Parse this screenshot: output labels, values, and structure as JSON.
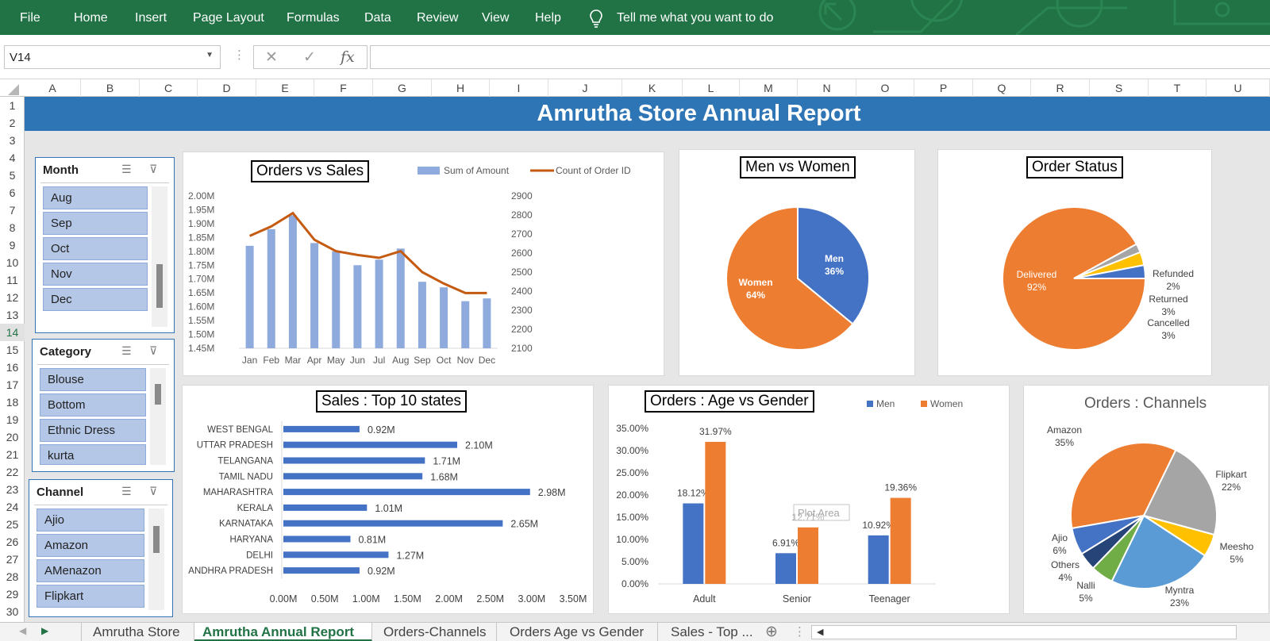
{
  "ribbon": {
    "tabs": [
      "File",
      "Home",
      "Insert",
      "Page Layout",
      "Formulas",
      "Data",
      "Review",
      "View",
      "Help"
    ],
    "tell_me": "Tell me what you want to do",
    "tell_me_icon": "lightbulb-icon",
    "bg_color": "#217346"
  },
  "formula_bar": {
    "name_box": "V14",
    "cancel_icon": "✕",
    "enter_icon": "✓",
    "fx_icon": "fx",
    "formula": ""
  },
  "grid": {
    "columns": [
      "A",
      "B",
      "C",
      "D",
      "E",
      "F",
      "G",
      "H",
      "I",
      "J",
      "K",
      "L",
      "M",
      "N",
      "O",
      "P",
      "Q",
      "R",
      "S",
      "T",
      "U"
    ],
    "rows": [
      "1",
      "2",
      "3",
      "4",
      "5",
      "6",
      "7",
      "8",
      "9",
      "10",
      "11",
      "12",
      "13",
      "14",
      "15",
      "16",
      "17",
      "18",
      "19",
      "20",
      "21",
      "22",
      "23",
      "24",
      "25",
      "26",
      "27",
      "28",
      "29",
      "30"
    ],
    "selected_row": "14"
  },
  "banner": {
    "title": "Amrutha Store Annual Report",
    "color": "#2e75b6"
  },
  "slicers": {
    "month": {
      "title": "Month",
      "items": [
        "Aug",
        "Sep",
        "Oct",
        "Nov",
        "Dec"
      ]
    },
    "category": {
      "title": "Category",
      "items": [
        "Blouse",
        "Bottom",
        "Ethnic Dress",
        "kurta"
      ]
    },
    "channel": {
      "title": "Channel",
      "items": [
        "Ajio",
        "Amazon",
        "AMenazon",
        "Flipkart"
      ]
    }
  },
  "chart_data": [
    {
      "id": "orders-vs-sales",
      "type": "bar",
      "title": "Orders vs Sales",
      "categories": [
        "Jan",
        "Feb",
        "Mar",
        "Apr",
        "May",
        "Jun",
        "Jul",
        "Aug",
        "Sep",
        "Oct",
        "Nov",
        "Dec"
      ],
      "series": [
        {
          "name": "Sum of Amount",
          "type": "bar",
          "axis": "left",
          "color": "#8faadc",
          "values": [
            1.82,
            1.88,
            1.93,
            1.83,
            1.8,
            1.75,
            1.77,
            1.81,
            1.69,
            1.67,
            1.62,
            1.63
          ]
        },
        {
          "name": "Count of Order ID",
          "type": "line",
          "axis": "right",
          "color": "#c55a11",
          "values": [
            2690,
            2740,
            2810,
            2670,
            2610,
            2590,
            2575,
            2610,
            2500,
            2440,
            2390,
            2390
          ]
        }
      ],
      "y_left": {
        "ticks": [
          "2.00M",
          "1.95M",
          "1.90M",
          "1.85M",
          "1.80M",
          "1.75M",
          "1.70M",
          "1.65M",
          "1.60M",
          "1.55M",
          "1.50M",
          "1.45M"
        ],
        "ylim": [
          1.45,
          2.0
        ]
      },
      "y_right": {
        "ticks": [
          "2900",
          "2800",
          "2700",
          "2600",
          "2500",
          "2400",
          "2300",
          "2200",
          "2100"
        ],
        "ylim": [
          2100,
          2900
        ]
      },
      "legend": "top-right"
    },
    {
      "id": "men-vs-women",
      "type": "pie",
      "title": "Men vs Women",
      "slices": [
        {
          "label": "Men",
          "value": 36,
          "text": "36%",
          "color": "#4472c4"
        },
        {
          "label": "Women",
          "value": 64,
          "text": "64%",
          "color": "#ed7d31"
        }
      ]
    },
    {
      "id": "order-status",
      "type": "pie",
      "title": "Order Status",
      "slices": [
        {
          "label": "Delivered",
          "value": 92,
          "text": "92%",
          "color": "#ed7d31"
        },
        {
          "label": "Refunded",
          "value": 2,
          "text": "2%",
          "color": "#a5a5a5"
        },
        {
          "label": "Returned",
          "value": 3,
          "text": "3%",
          "color": "#ffc000"
        },
        {
          "label": "Cancelled",
          "value": 3,
          "text": "3%",
          "color": "#4472c4"
        }
      ]
    },
    {
      "id": "top-states",
      "type": "bar",
      "orientation": "horizontal",
      "title": "Sales : Top 10 states",
      "categories": [
        "WEST BENGAL",
        "UTTAR PRADESH",
        "TELANGANA",
        "TAMIL NADU",
        "MAHARASHTRA",
        "KERALA",
        "KARNATAKA",
        "HARYANA",
        "DELHI",
        "ANDHRA PRADESH"
      ],
      "values": [
        0.92,
        2.1,
        1.71,
        1.68,
        2.98,
        1.01,
        2.65,
        0.81,
        1.27,
        0.92
      ],
      "labels": [
        "0.92M",
        "2.10M",
        "1.71M",
        "1.68M",
        "2.98M",
        "1.01M",
        "2.65M",
        "0.81M",
        "1.27M",
        "0.92M"
      ],
      "x_ticks": [
        "0.00M",
        "0.50M",
        "1.00M",
        "1.50M",
        "2.00M",
        "2.50M",
        "3.00M",
        "3.50M"
      ],
      "xlim": [
        0,
        3.5
      ],
      "color": "#4472c4"
    },
    {
      "id": "age-vs-gender",
      "type": "bar",
      "title": "Orders : Age vs Gender",
      "categories": [
        "Adult",
        "Senior",
        "Teenager"
      ],
      "series": [
        {
          "name": "Men",
          "color": "#4472c4",
          "values": [
            18.12,
            6.91,
            10.92
          ],
          "labels": [
            "18.12%",
            "6.91%",
            "10.92%"
          ]
        },
        {
          "name": "Women",
          "color": "#ed7d31",
          "values": [
            31.97,
            12.71,
            19.36
          ],
          "labels": [
            "31.97%",
            "12.71%",
            "19.36%"
          ]
        }
      ],
      "y_ticks": [
        "35.00%",
        "30.00%",
        "25.00%",
        "20.00%",
        "15.00%",
        "10.00%",
        "5.00%",
        "0.00%"
      ],
      "ylim": [
        0,
        35
      ],
      "tooltip": "Plot Area",
      "legend": "top-right"
    },
    {
      "id": "channels",
      "type": "pie",
      "title": "Orders : Channels",
      "slices": [
        {
          "label": "Amazon",
          "value": 35,
          "text": "35%",
          "color": "#ed7d31"
        },
        {
          "label": "Flipkart",
          "value": 22,
          "text": "22%",
          "color": "#a5a5a5"
        },
        {
          "label": "Meesho",
          "value": 5,
          "text": "5%",
          "color": "#ffc000"
        },
        {
          "label": "Myntra",
          "value": 23,
          "text": "23%",
          "color": "#5b9bd5"
        },
        {
          "label": "Nalli",
          "value": 5,
          "text": "5%",
          "color": "#70ad47"
        },
        {
          "label": "Others",
          "value": 4,
          "text": "4%",
          "color": "#264478"
        },
        {
          "label": "Ajio",
          "value": 6,
          "text": "6%",
          "color": "#4472c4"
        }
      ]
    }
  ],
  "sheet_tabs": [
    "Amrutha Store",
    "Amrutha Annual Report",
    "Orders-Channels",
    "Orders Age vs Gender",
    "Sales - Top ..."
  ],
  "active_tab": "Amrutha Annual Report",
  "add_sheet_icon": "⊕"
}
